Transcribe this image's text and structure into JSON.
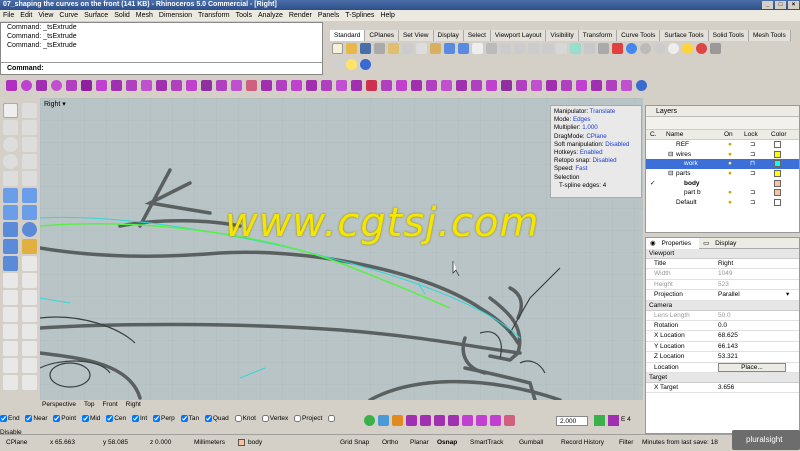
{
  "window": {
    "title": "07_shaping the curves on the front (141 KB) - Rhinoceros 5.0 Commercial - [Right]"
  },
  "menu": [
    "File",
    "Edit",
    "View",
    "Curve",
    "Surface",
    "Solid",
    "Mesh",
    "Dimension",
    "Transform",
    "Tools",
    "Analyze",
    "Render",
    "Panels",
    "T-Splines",
    "Help"
  ],
  "command_history": [
    "Command: _tsExtrude",
    "Command: _tsExtrude",
    "Command: _tsExtrude"
  ],
  "command_prompt": "Command:",
  "toolbar_tabs": [
    "Standard",
    "CPlanes",
    "Set View",
    "Display",
    "Select",
    "Viewport Layout",
    "Visibility",
    "Transform",
    "Curve Tools",
    "Surface Tools",
    "Solid Tools",
    "Mesh Tools"
  ],
  "viewport": {
    "label": "Right",
    "tabs": [
      "Perspective",
      "Top",
      "Front",
      "Right"
    ]
  },
  "tsplines_info": [
    {
      "k": "Manipulator:",
      "v": "Translate"
    },
    {
      "k": "Mode:",
      "v": "Edges"
    },
    {
      "k": "Multiplier:",
      "v": "1.000"
    },
    {
      "k": "DragMode:",
      "v": "CPlane"
    },
    {
      "k": "Soft manipulation:",
      "v": "Disabled"
    },
    {
      "k": "Hotkeys:",
      "v": "Enabled"
    },
    {
      "k": "Retopo snap:",
      "v": "Disabled"
    },
    {
      "k": "Speed:",
      "v": "Fast"
    },
    {
      "k": "Selection",
      "v": ""
    },
    {
      "k": "  T-spline edges:",
      "v": "4"
    }
  ],
  "watermark": "www.cgtsj.com",
  "layers_panel": {
    "title": "Layers",
    "columns": {
      "c": "C.",
      "name": "Name",
      "on": "On",
      "lock": "Lock",
      "color": "Color"
    },
    "rows": [
      {
        "name": "REF",
        "indent": 0,
        "color": "#ffffff",
        "check": ""
      },
      {
        "name": "wires",
        "indent": 1,
        "color": "#ffff00",
        "check": ""
      },
      {
        "name": "work",
        "indent": 2,
        "color": "#00ffff",
        "check": "",
        "selected": true
      },
      {
        "name": "parts",
        "indent": 1,
        "color": "#ffff00",
        "check": ""
      },
      {
        "name": "body",
        "indent": 2,
        "color": "#ffc0a0",
        "check": "✓",
        "bold": true
      },
      {
        "name": "part b",
        "indent": 2,
        "color": "#ffc0a0",
        "check": ""
      },
      {
        "name": "Default",
        "indent": 1,
        "color": "#ffffff",
        "check": ""
      }
    ]
  },
  "properties_panel": {
    "tabs": [
      "Properties",
      "Display"
    ],
    "sections": [
      {
        "title": "Viewport",
        "rows": [
          {
            "k": "Title",
            "v": "Right",
            "grey": false
          },
          {
            "k": "Width",
            "v": "1049",
            "grey": true
          },
          {
            "k": "Height",
            "v": "523",
            "grey": true
          },
          {
            "k": "Projection",
            "v": "Parallel",
            "grey": false
          }
        ]
      },
      {
        "title": "Camera",
        "rows": [
          {
            "k": "Lens Length",
            "v": "50.0",
            "grey": true
          },
          {
            "k": "Rotation",
            "v": "0.0",
            "grey": false
          },
          {
            "k": "X Location",
            "v": "68.625",
            "grey": false
          },
          {
            "k": "Y Location",
            "v": "66.143",
            "grey": false
          },
          {
            "k": "Z Location",
            "v": "53.321",
            "grey": false
          },
          {
            "k": "Location",
            "v": "Place...",
            "grey": false
          }
        ]
      },
      {
        "title": "Target",
        "rows": [
          {
            "k": "X Target",
            "v": "3.656",
            "grey": false
          }
        ]
      }
    ]
  },
  "osnaps": [
    {
      "label": "End",
      "checked": true
    },
    {
      "label": "Near",
      "checked": true
    },
    {
      "label": "Point",
      "checked": true
    },
    {
      "label": "Mid",
      "checked": true
    },
    {
      "label": "Cen",
      "checked": true
    },
    {
      "label": "Int",
      "checked": true
    },
    {
      "label": "Perp",
      "checked": true
    },
    {
      "label": "Tan",
      "checked": true
    },
    {
      "label": "Quad",
      "checked": true
    },
    {
      "label": "Knot",
      "checked": false
    },
    {
      "label": "Vertex",
      "checked": false
    },
    {
      "label": "Project",
      "checked": false
    },
    {
      "label": "Disable",
      "checked": false
    }
  ],
  "nudge_value": "2.000",
  "edge_count_label": "E 4",
  "status": {
    "cplane": "CPlane",
    "x": "x 65.663",
    "y": "y 58.085",
    "z": "z 0.000",
    "units": "Millimeters",
    "layer": "body",
    "grid_snap": "Grid Snap",
    "ortho": "Ortho",
    "planar": "Planar",
    "osnap": "Osnap",
    "smarttrack": "SmartTrack",
    "gumball": "Gumball",
    "record_history": "Record History",
    "filter": "Filter",
    "save_info": "Minutes from last save: 18"
  },
  "brand": "pluralsight"
}
